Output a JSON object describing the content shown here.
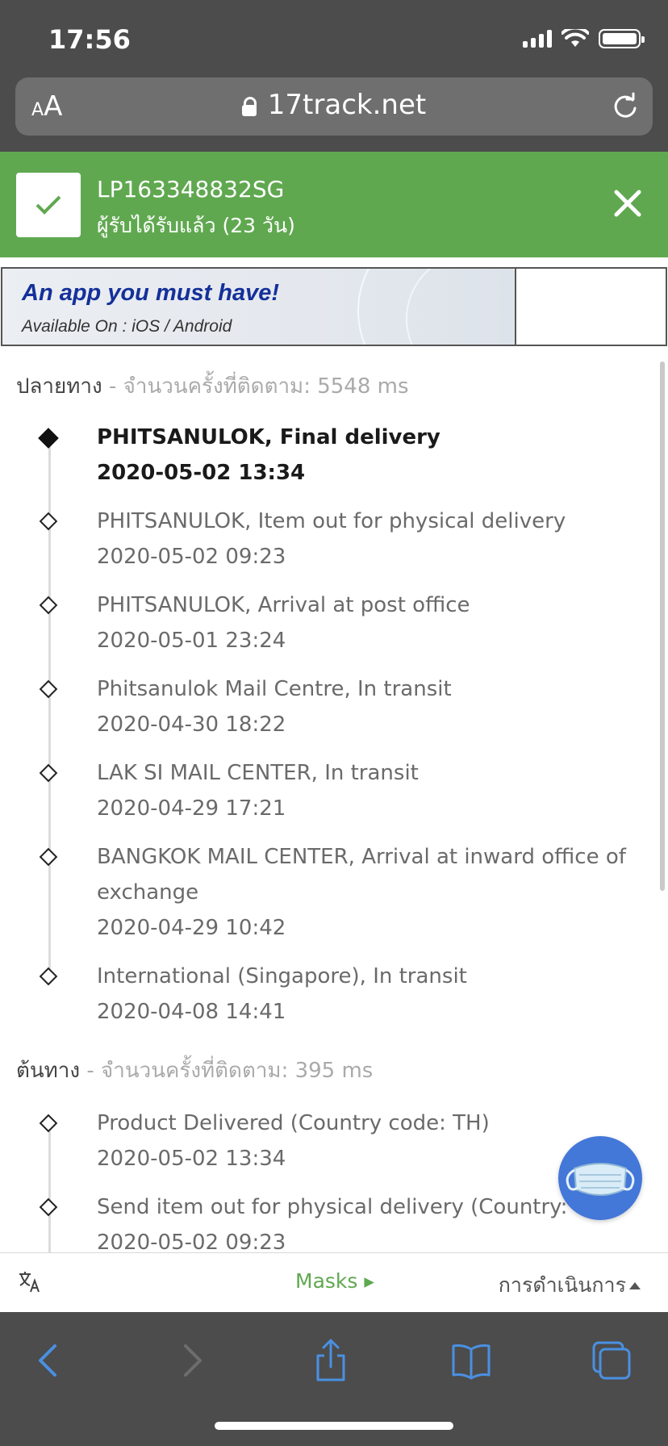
{
  "status_bar": {
    "time": "17:56"
  },
  "browser": {
    "text_size_label": "AA",
    "url": "17track.net"
  },
  "header": {
    "tracking_number": "LP163348832SG",
    "status": "ผู้รับได้รับแล้ว (23 วัน)",
    "colors": {
      "success": "#60a850"
    }
  },
  "banner": {
    "title": "An app you must have!",
    "subtitle": "Available On : iOS / Android"
  },
  "destination": {
    "label": "ปลายทาง",
    "meta": " - จำนวนครั้งที่ติดตาม: 5548 ms",
    "events": [
      {
        "desc": "PHITSANULOK, Final delivery",
        "time": "2020-05-02 13:34"
      },
      {
        "desc": "PHITSANULOK, Item out for physical delivery",
        "time": "2020-05-02 09:23"
      },
      {
        "desc": "PHITSANULOK, Arrival at post office",
        "time": "2020-05-01 23:24"
      },
      {
        "desc": "Phitsanulok Mail Centre, In transit",
        "time": "2020-04-30 18:22"
      },
      {
        "desc": "LAK SI MAIL CENTER, In transit",
        "time": "2020-04-29 17:21"
      },
      {
        "desc": "BANGKOK MAIL CENTER, Arrival at inward office of exchange",
        "time": "2020-04-29 10:42"
      },
      {
        "desc": "International (Singapore), In transit",
        "time": "2020-04-08 14:41"
      }
    ]
  },
  "origin": {
    "label": "ต้นทาง",
    "meta": " - จำนวนครั้งที่ติดตาม: 395 ms",
    "events": [
      {
        "desc": "Product Delivered (Country code: TH)",
        "time": "2020-05-02 13:34"
      },
      {
        "desc": "Send item out for physical delivery (Country: TH)",
        "time": "2020-05-02 09:23"
      }
    ]
  },
  "page_bar": {
    "masks_label": "Masks ▸",
    "action_label": "การดำเนินการ"
  },
  "icons": [
    "check-icon",
    "close-icon",
    "lock-icon",
    "reload-icon",
    "translate-icon",
    "mask-icon",
    "back-icon",
    "forward-icon",
    "share-icon",
    "bookmarks-icon",
    "tabs-icon"
  ]
}
